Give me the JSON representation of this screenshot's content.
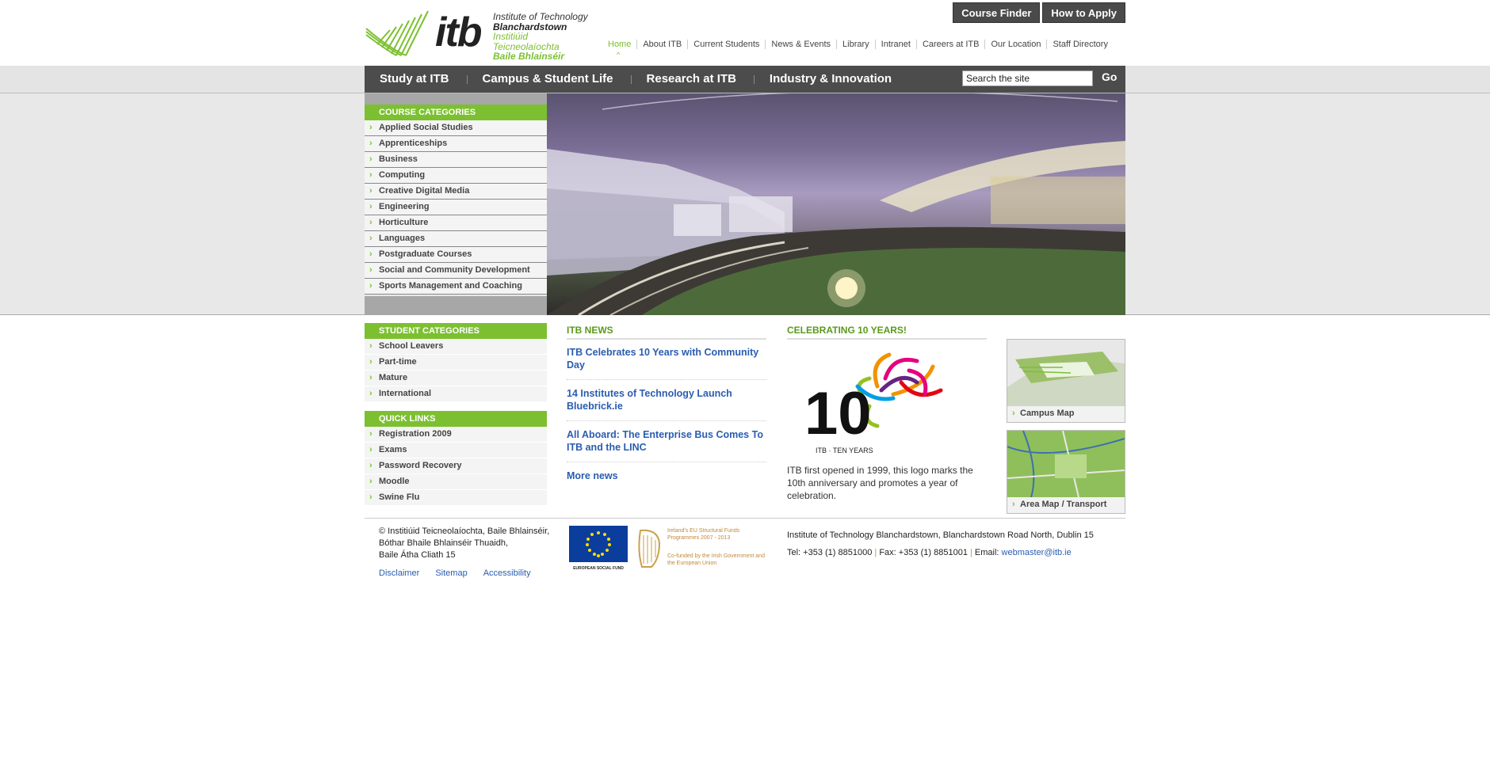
{
  "logo": {
    "wordmark": "itb",
    "line1": "Institute of Technology",
    "line2": "Blanchardstown",
    "line3": "Institiúid Teicneolaíochta",
    "line4": "Baile Bhlainséir"
  },
  "top_buttons": [
    "Course Finder",
    "How to Apply"
  ],
  "util_nav": [
    "Home",
    "About ITB",
    "Current Students",
    "News & Events",
    "Library",
    "Intranet",
    "Careers at ITB",
    "Our Location",
    "Staff Directory"
  ],
  "main_nav": [
    "Study at ITB",
    "Campus & Student Life",
    "Research at ITB",
    "Industry & Innovation"
  ],
  "search": {
    "value": "Search the site",
    "go": "Go"
  },
  "course_categories": {
    "title": "COURSE CATEGORIES",
    "items": [
      "Applied Social Studies",
      "Apprenticeships",
      "Business",
      "Computing",
      "Creative Digital Media",
      "Engineering",
      "Horticulture",
      "Languages",
      "Postgraduate Courses",
      "Social and Community Development",
      "Sports Management and Coaching"
    ]
  },
  "student_categories": {
    "title": "STUDENT CATEGORIES",
    "items": [
      "School Leavers",
      "Part-time",
      "Mature",
      "International"
    ]
  },
  "quick_links": {
    "title": "QUICK LINKS",
    "items": [
      "Registration 2009",
      "Exams",
      "Password Recovery",
      "Moodle",
      "Swine Flu"
    ]
  },
  "news": {
    "title": "ITB NEWS",
    "items": [
      "ITB Celebrates 10 Years with Community Day",
      "14 Institutes of Technology Launch Bluebrick.ie",
      "All Aboard: The Enterprise Bus Comes To ITB and the LINC"
    ],
    "more": "More news"
  },
  "celebrating": {
    "title": "CELEBRATING 10 YEARS!",
    "logo_caption": "ITB · TEN YEARS",
    "logo_number": "10",
    "text": "ITB first opened in 1999, this logo marks the 10th anniversary and promotes a year of celebration."
  },
  "maps": [
    "Campus Map",
    "Area Map / Transport"
  ],
  "footer": {
    "address_lines": [
      "© Institiúid Teicneolaíochta, Baile Bhlainséir,",
      "Bóthar Bhaile Bhlainséir Thuaidh,",
      "Baile Átha Cliath 15"
    ],
    "links": [
      "Disclaimer",
      "Sitemap",
      "Accessibility"
    ],
    "eu_label": "EUROPEAN SOCIAL FUND",
    "eu_text1": "Ireland's EU Structural Funds Programmes 2007 - 2013",
    "eu_text2": "Co-funded by the Irish Government and the European Union",
    "institute": "Institute of Technology Blanchardstown, Blanchardstown Road North, Dublin 15",
    "tel": "Tel: +353 (1) 8851000",
    "fax": "Fax: +353 (1) 8851001",
    "email_label": "Email:",
    "email": "webmaster@itb.ie"
  },
  "colors": {
    "accent_green": "#7cc031",
    "nav_gray": "#4c4c4c",
    "link_blue": "#2a5db0"
  }
}
